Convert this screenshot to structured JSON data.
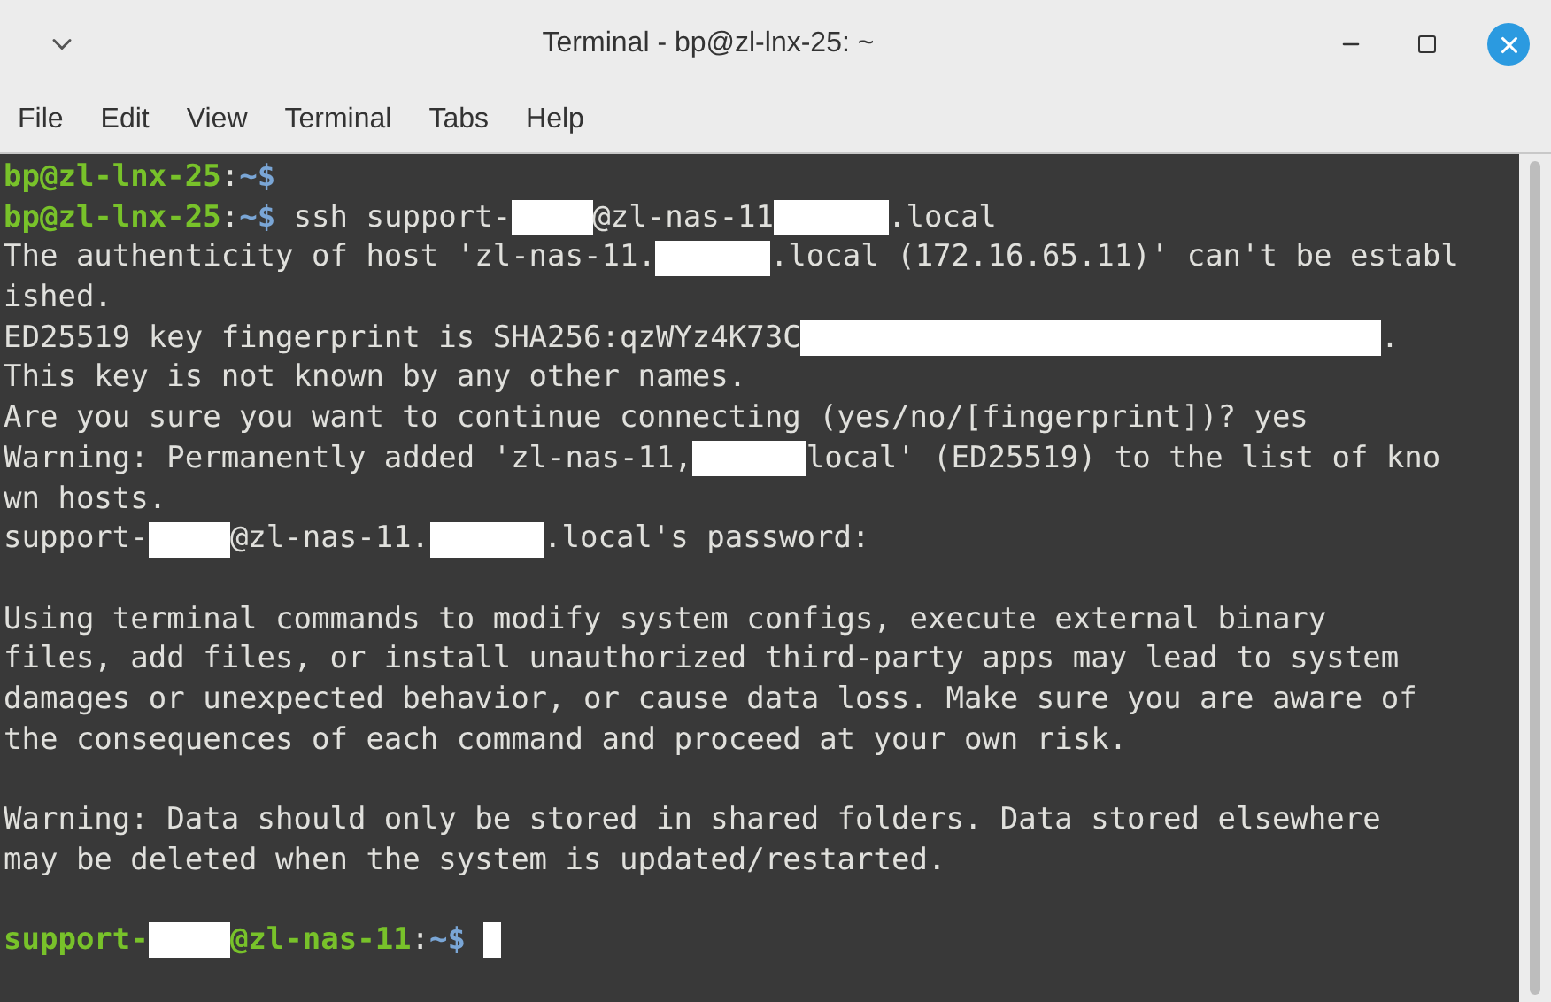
{
  "window": {
    "title": "Terminal - bp@zl-lnx-25: ~"
  },
  "menu": [
    "File",
    "Edit",
    "View",
    "Terminal",
    "Tabs",
    "Help"
  ],
  "terminal": {
    "lines": [
      {
        "kind": "text",
        "segments": [
          {
            "kind": "user",
            "text": "bp@zl-lnx-25"
          },
          {
            "kind": "plain",
            "text": ":"
          },
          {
            "kind": "path",
            "text": "~$"
          }
        ]
      },
      {
        "kind": "text",
        "segments": [
          {
            "kind": "user",
            "text": "bp@zl-lnx-25"
          },
          {
            "kind": "plain",
            "text": ":"
          },
          {
            "kind": "path",
            "text": "~$"
          },
          {
            "kind": "plain",
            "text": " ssh support-"
          },
          {
            "kind": "mask-s"
          },
          {
            "kind": "plain",
            "text": "@zl-nas-11"
          },
          {
            "kind": "mask-m"
          },
          {
            "kind": "plain",
            "text": ".local"
          }
        ]
      },
      {
        "kind": "text",
        "segments": [
          {
            "kind": "plain",
            "text": "The authenticity of host 'zl-nas-11."
          },
          {
            "kind": "mask-m"
          },
          {
            "kind": "plain",
            "text": ".local (172.16.65.11)' can't be establ"
          }
        ]
      },
      {
        "kind": "text",
        "segments": [
          {
            "kind": "plain",
            "text": "ished."
          }
        ]
      },
      {
        "kind": "text",
        "segments": [
          {
            "kind": "plain",
            "text": "ED25519 key fingerprint is SHA256:qzWYz4K73C"
          },
          {
            "kind": "mask-xl"
          },
          {
            "kind": "plain",
            "text": "."
          }
        ]
      },
      {
        "kind": "text",
        "segments": [
          {
            "kind": "plain",
            "text": "This key is not known by any other names."
          }
        ]
      },
      {
        "kind": "text",
        "segments": [
          {
            "kind": "plain",
            "text": "Are you sure you want to continue connecting (yes/no/[fingerprint])? yes"
          }
        ]
      },
      {
        "kind": "text",
        "segments": [
          {
            "kind": "plain",
            "text": "Warning: Permanently added 'zl-nas-11,"
          },
          {
            "kind": "mask-m"
          },
          {
            "kind": "plain",
            "text": "local' (ED25519) to the list of kno"
          }
        ]
      },
      {
        "kind": "text",
        "segments": [
          {
            "kind": "plain",
            "text": "wn hosts."
          }
        ]
      },
      {
        "kind": "text",
        "segments": [
          {
            "kind": "plain",
            "text": "support-"
          },
          {
            "kind": "mask-s"
          },
          {
            "kind": "plain",
            "text": "@zl-nas-11."
          },
          {
            "kind": "mask-m"
          },
          {
            "kind": "plain",
            "text": ".local's password:"
          }
        ]
      },
      {
        "kind": "blank"
      },
      {
        "kind": "text",
        "segments": [
          {
            "kind": "plain",
            "text": "Using terminal commands to modify system configs, execute external binary"
          }
        ]
      },
      {
        "kind": "text",
        "segments": [
          {
            "kind": "plain",
            "text": "files, add files, or install unauthorized third-party apps may lead to system"
          }
        ]
      },
      {
        "kind": "text",
        "segments": [
          {
            "kind": "plain",
            "text": "damages or unexpected behavior, or cause data loss. Make sure you are aware of"
          }
        ]
      },
      {
        "kind": "text",
        "segments": [
          {
            "kind": "plain",
            "text": "the consequences of each command and proceed at your own risk."
          }
        ]
      },
      {
        "kind": "blank"
      },
      {
        "kind": "text",
        "segments": [
          {
            "kind": "plain",
            "text": "Warning: Data should only be stored in shared folders. Data stored elsewhere"
          }
        ]
      },
      {
        "kind": "text",
        "segments": [
          {
            "kind": "plain",
            "text": "may be deleted when the system is updated/restarted."
          }
        ]
      },
      {
        "kind": "blank"
      },
      {
        "kind": "prompt",
        "segments": [
          {
            "kind": "user",
            "text": "support-"
          },
          {
            "kind": "mask-s"
          },
          {
            "kind": "user",
            "text": "@zl-nas-11"
          },
          {
            "kind": "plain",
            "text": ":"
          },
          {
            "kind": "path",
            "text": "~$"
          }
        ]
      }
    ]
  }
}
